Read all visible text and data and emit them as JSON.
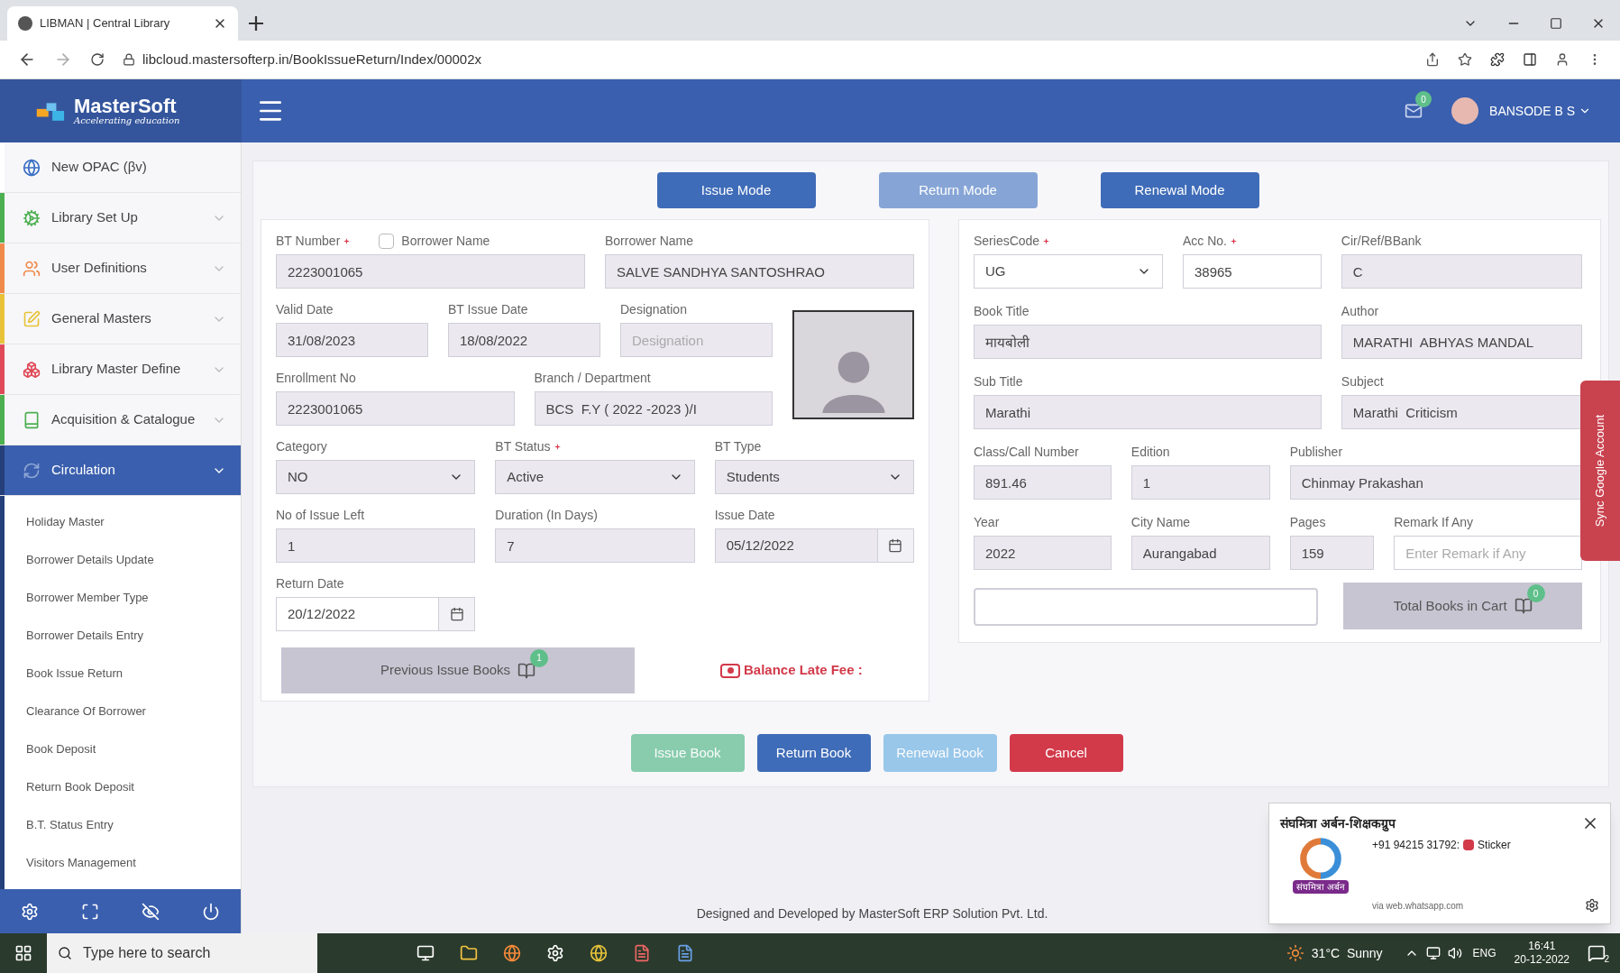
{
  "browser": {
    "tab_title": "LIBMAN | Central Library",
    "url": "libcloud.mastersofterp.in/BookIssueReturn/Index/00002x"
  },
  "header": {
    "logo": "MasterSoft",
    "tagline": "Accelerating education",
    "mail_count": "0",
    "user": "BANSODE B S"
  },
  "sidebar": {
    "items": [
      {
        "label": "New OPAC (βv)",
        "color": "#ffffff",
        "expanded": false,
        "has_menu": false
      },
      {
        "label": "Library Set Up",
        "color": "#4caf50",
        "expanded": false,
        "has_menu": true
      },
      {
        "label": "User Definitions",
        "color": "#f08a4b",
        "expanded": false,
        "has_menu": true
      },
      {
        "label": "General Masters",
        "color": "#e8c33a",
        "expanded": false,
        "has_menu": true
      },
      {
        "label": "Library Master Define",
        "color": "#e04a58",
        "expanded": false,
        "has_menu": true
      },
      {
        "label": "Acquisition & Catalogue",
        "color": "#4caf50",
        "expanded": false,
        "has_menu": true
      },
      {
        "label": "Circulation",
        "color": "#253f7a",
        "expanded": true,
        "has_menu": true,
        "children": [
          "Holiday Master",
          "Borrower Details Update",
          "Borrower Member Type",
          "Borrower Details Entry",
          "Book Issue Return",
          "Clearance Of Borrower",
          "Book Deposit",
          "Return Book Deposit",
          "B.T. Status Entry",
          "Visitors Management"
        ]
      }
    ]
  },
  "modes": [
    {
      "label": "Issue Mode",
      "selected": false
    },
    {
      "label": "Return Mode",
      "selected": true
    },
    {
      "label": "Renewal Mode",
      "selected": false
    }
  ],
  "borrower": {
    "borrower_name_toggle": {
      "label": "Borrower Name",
      "checked": false
    },
    "rows": [
      [
        {
          "label": "BT Number",
          "required": true,
          "kind": "text",
          "readonly": true,
          "value": "2223001065"
        },
        {
          "label": "Borrower Name",
          "required": false,
          "kind": "text",
          "readonly": true,
          "value": "SALVE SANDHYA SANTOSHRAO"
        }
      ],
      [
        {
          "label": "Valid Date",
          "required": false,
          "kind": "text",
          "readonly": true,
          "value": "31/08/2023"
        },
        {
          "label": "BT Issue Date",
          "required": false,
          "kind": "text",
          "readonly": true,
          "value": "18/08/2022"
        },
        {
          "label": "Designation",
          "required": false,
          "kind": "text",
          "readonly": true,
          "placeholder": "Designation"
        }
      ],
      [
        {
          "label": "Enrollment No",
          "required": false,
          "kind": "text",
          "readonly": true,
          "value": "2223001065"
        },
        {
          "label": "Branch / Department",
          "required": false,
          "kind": "text",
          "readonly": true,
          "value": "BCS  F.Y ( 2022 -2023 )/I"
        }
      ],
      [
        {
          "label": "Category",
          "required": false,
          "kind": "select",
          "readonly": true,
          "value": "NO"
        },
        {
          "label": "BT Status",
          "required": true,
          "kind": "select",
          "readonly": true,
          "value": "Active"
        },
        {
          "label": "BT Type",
          "required": false,
          "kind": "select",
          "readonly": true,
          "value": "Students"
        }
      ],
      [
        {
          "label": "No of Issue Left",
          "required": false,
          "kind": "text",
          "readonly": true,
          "value": "1"
        },
        {
          "label": "Duration (In Days)",
          "required": false,
          "kind": "text",
          "readonly": true,
          "value": "7"
        },
        {
          "label": "Issue Date",
          "required": false,
          "kind": "date",
          "readonly": true,
          "value": "05/12/2022"
        }
      ],
      [
        {
          "label": "Return Date",
          "required": false,
          "kind": "date",
          "readonly": false,
          "value": "20/12/2022"
        }
      ]
    ],
    "previous_button": {
      "label": "Previous Issue Books",
      "count": "1"
    },
    "late_fee": "Balance Late Fee :"
  },
  "book": {
    "rows": [
      [
        {
          "label": "SeriesCode",
          "required": true,
          "kind": "select",
          "readonly": false,
          "value": "UG"
        },
        {
          "label": "Acc No.",
          "required": true,
          "kind": "text",
          "readonly": false,
          "value": "38965"
        },
        {
          "label": "Cir/Ref/BBank",
          "required": false,
          "kind": "text",
          "readonly": true,
          "value": "C"
        }
      ],
      [
        {
          "label": "Book Title",
          "required": false,
          "kind": "text",
          "readonly": true,
          "value": "मायबोली"
        },
        {
          "label": "Author",
          "required": false,
          "kind": "text",
          "readonly": true,
          "value": "MARATHI  ABHYAS MANDAL"
        }
      ],
      [
        {
          "label": "Sub Title",
          "required": false,
          "kind": "text",
          "readonly": true,
          "value": "Marathi"
        },
        {
          "label": "Subject",
          "required": false,
          "kind": "text",
          "readonly": true,
          "value": "Marathi  Criticism"
        }
      ],
      [
        {
          "label": "Class/Call Number",
          "required": false,
          "kind": "text",
          "readonly": true,
          "value": "891.46"
        },
        {
          "label": "Edition",
          "required": false,
          "kind": "text",
          "readonly": true,
          "value": "1"
        },
        {
          "label": "Publisher",
          "required": false,
          "kind": "text",
          "readonly": true,
          "value": "Chinmay Prakashan"
        }
      ],
      [
        {
          "label": "Year",
          "required": false,
          "kind": "text",
          "readonly": true,
          "value": "2022"
        },
        {
          "label": "City Name",
          "required": false,
          "kind": "text",
          "readonly": true,
          "value": "Aurangabad"
        },
        {
          "label": "Pages",
          "required": false,
          "kind": "text",
          "readonly": true,
          "value": "159"
        },
        {
          "label": "Remark If Any",
          "required": false,
          "kind": "text",
          "readonly": false,
          "placeholder": "Enter Remark if Any"
        }
      ]
    ],
    "cart_button": {
      "label": "Total Books in Cart",
      "count": "0"
    }
  },
  "actions": [
    {
      "label": "Issue Book",
      "kind": "success",
      "disabled": true
    },
    {
      "label": "Return Book",
      "kind": "primary",
      "disabled": false
    },
    {
      "label": "Renewal Book",
      "kind": "info",
      "disabled": true
    },
    {
      "label": "Cancel",
      "kind": "danger",
      "disabled": false
    }
  ],
  "sync_tab": "Sync Google Account",
  "footer": "Designed and Developed by MasterSoft ERP Solution Pvt. Ltd.",
  "notification": {
    "title": "संघमित्रा अर्बन-शिक्षकग्रुप",
    "sender": "+91 94215 31792:",
    "message": "Sticker",
    "logo_text": "संघमित्रा अर्बन",
    "source": "via web.whatsapp.com"
  },
  "taskbar": {
    "search_placeholder": "Type here to search",
    "weather": "31°C  Sunny",
    "language": "ENG",
    "time": "16:41",
    "date": "20-12-2022",
    "notifications": "2"
  }
}
